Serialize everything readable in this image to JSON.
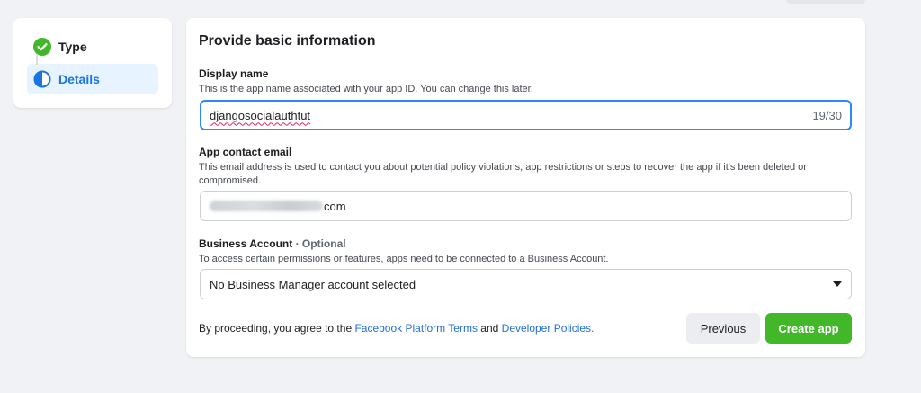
{
  "sidebar": {
    "steps": [
      {
        "label": "Type",
        "state": "complete",
        "icon": "check-circle-icon"
      },
      {
        "label": "Details",
        "state": "active",
        "icon": "half-circle-icon"
      }
    ]
  },
  "form": {
    "title": "Provide basic information",
    "display_name": {
      "label": "Display name",
      "help": "This is the app name associated with your app ID. You can change this later.",
      "value": "djangosocialauthtut",
      "counter": "19/30"
    },
    "contact_email": {
      "label": "App contact email",
      "help": "This email address is used to contact you about potential policy violations, app restrictions or steps to recover the app if it's been deleted or compromised.",
      "value_suffix": "com"
    },
    "business_account": {
      "label": "Business Account",
      "optional": "· Optional",
      "help": "To access certain permissions or features, apps need to be connected to a Business Account.",
      "selected": "No Business Manager account selected"
    }
  },
  "footer": {
    "prefix": "By proceeding, you agree to the ",
    "terms_link": "Facebook Platform Terms",
    "and": " and ",
    "policies_link": "Developer Policies."
  },
  "buttons": {
    "previous": "Previous",
    "create": "Create app"
  },
  "colors": {
    "accent_blue": "#1b74e4",
    "link_blue": "#216fdb",
    "success_green": "#42b72a",
    "page_bg": "#f0f2f5"
  }
}
